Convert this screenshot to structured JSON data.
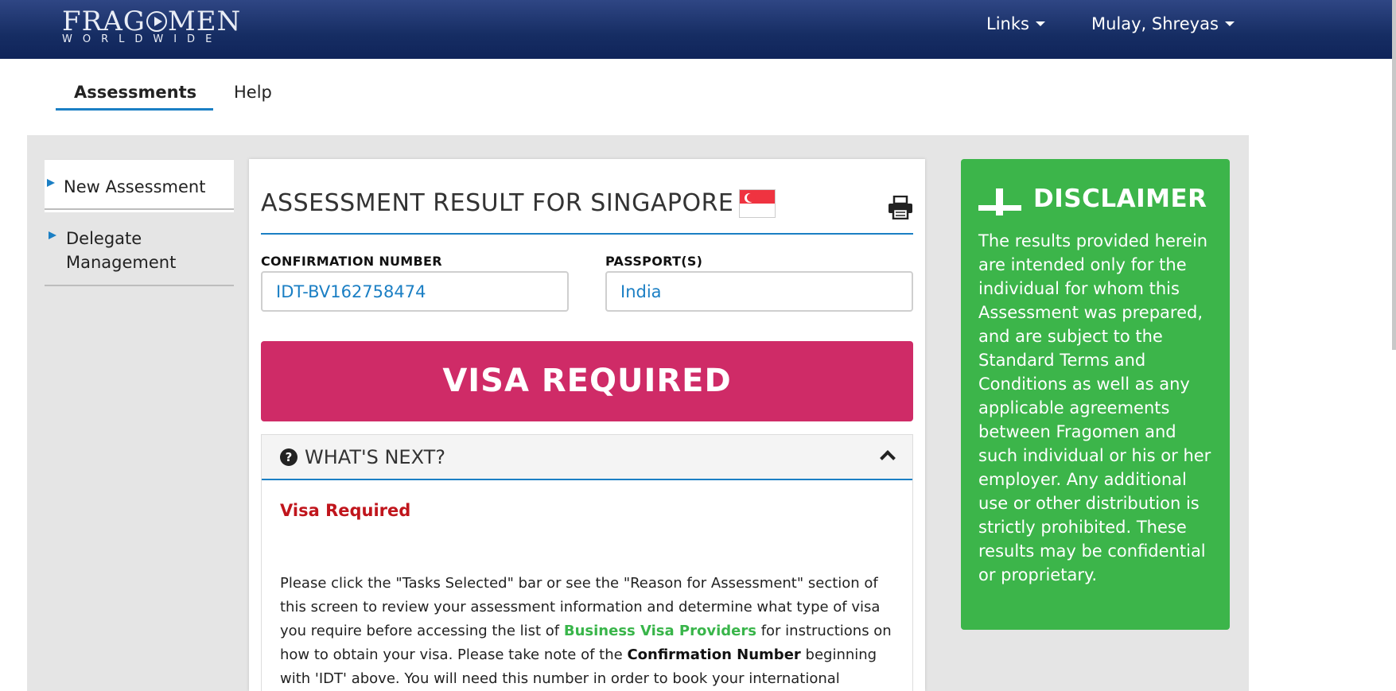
{
  "header": {
    "logo_main": "FRAGOMEN",
    "logo_sub": "WORLDWIDE",
    "links_label": "Links",
    "user_label": "Mulay, Shreyas"
  },
  "tabs": [
    {
      "label": "Assessments",
      "active": true
    },
    {
      "label": "Help",
      "active": false
    }
  ],
  "sidebar": {
    "items": [
      {
        "label": "New Assessment"
      },
      {
        "label": "Delegate Management"
      }
    ]
  },
  "result": {
    "title": "ASSESSMENT RESULT FOR SINGAPORE",
    "confirmation_label": "CONFIRMATION NUMBER",
    "confirmation_value": "IDT-BV162758474",
    "passport_label": "PASSPORT(S)",
    "passport_value": "India",
    "status": "VISA REQUIRED",
    "status_color": "#cf2b67"
  },
  "whats_next": {
    "title": "WHAT'S NEXT?",
    "subtitle": "Visa Required",
    "p1": "Please click the \"Tasks Selected\" bar or see the \"Reason for Assessment\" section of this screen to review your assessment information and determine what type of visa you require before accessing the list of",
    "link": "Business Visa Providers",
    "p2": "for instructions on how to obtain your visa. Please take note of the",
    "bold": "Confirmation Number",
    "p3": "beginning with 'IDT' above. You will need this number in order to book your international"
  },
  "disclaimer": {
    "title": "DISCLAIMER",
    "text": "The results provided herein are intended only for the individual for whom this Assessment was prepared, and are subject to the Standard Terms and Conditions as well as any applicable agreements between Fragomen and such individual or his or her employer. Any additional use or other distribution is strictly prohibited. These results may be confidential or proprietary.",
    "color": "#3cb54a"
  }
}
